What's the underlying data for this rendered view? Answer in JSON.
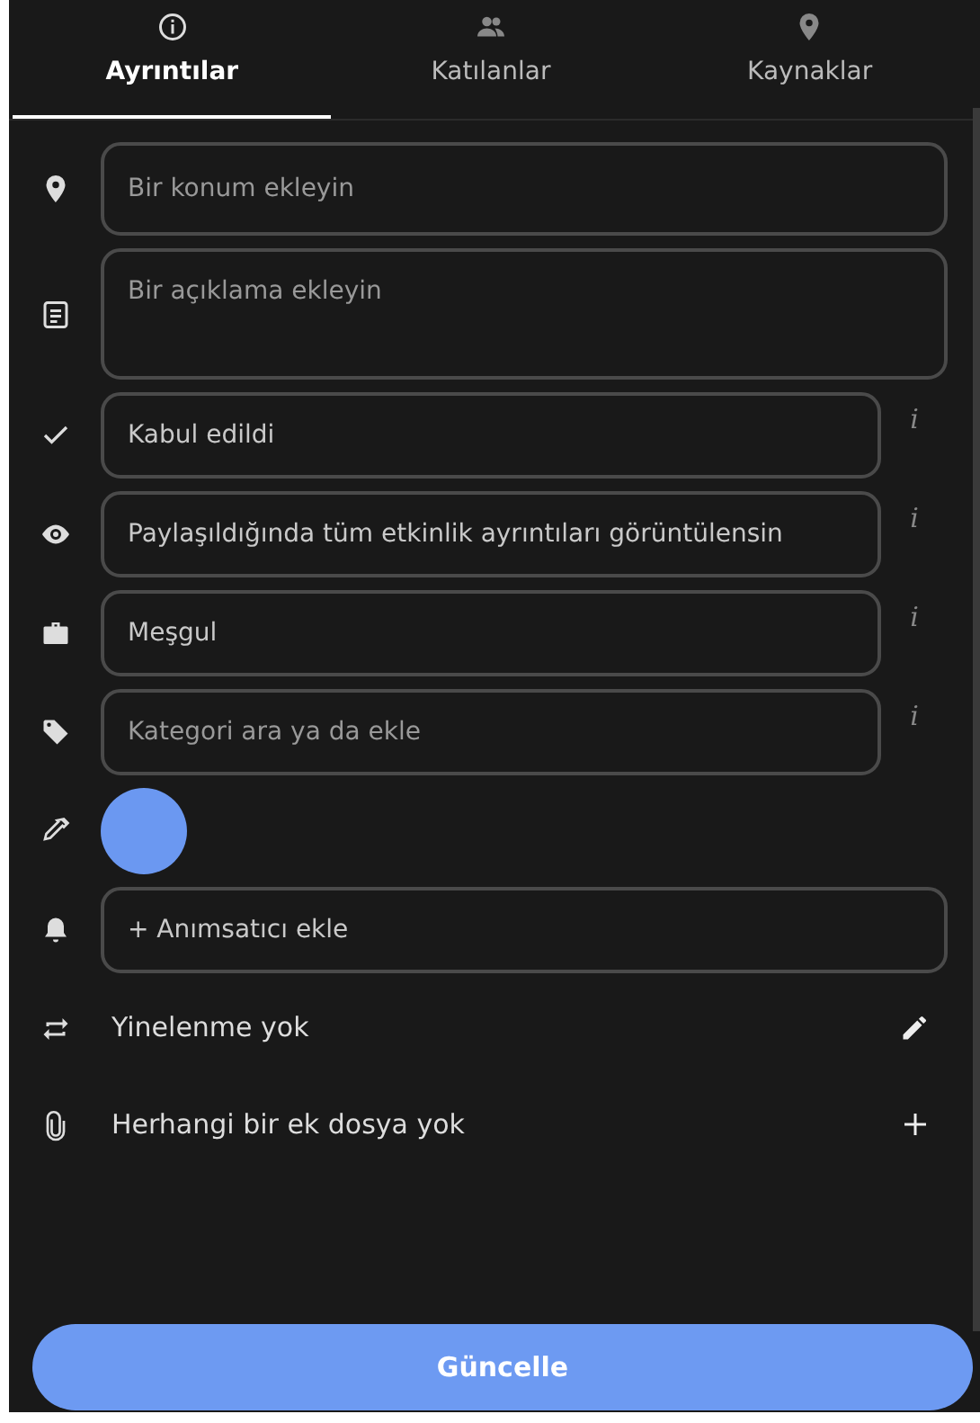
{
  "tabs": [
    {
      "label": "Ayrıntılar",
      "selected": true
    },
    {
      "label": "Katılanlar",
      "selected": false
    },
    {
      "label": "Kaynaklar",
      "selected": false
    }
  ],
  "rows": [
    {
      "kind": "field",
      "placeholder": "Bir konum ekleyin"
    },
    {
      "kind": "textarea",
      "placeholder": "Bir açıklama ekleyin"
    },
    {
      "kind": "select",
      "value": "Kabul edildi",
      "info": "i"
    },
    {
      "kind": "select",
      "value": "Paylaşıldığında tüm etkinlik ayrıntıları görüntülensin",
      "info": "i"
    },
    {
      "kind": "select",
      "value": "Meşgul",
      "info": "i"
    },
    {
      "kind": "category",
      "placeholder": "Kategori ara ya da ekle",
      "info": "i"
    },
    {
      "kind": "color",
      "color": "#6b98f1"
    },
    {
      "kind": "reminder",
      "label": "+ Anımsatıcı ekle"
    },
    {
      "kind": "edit",
      "text": "Yinelenme yok"
    },
    {
      "kind": "add",
      "text": "Herhangi bir ek dosya yok"
    }
  ],
  "submit": "Güncelle"
}
